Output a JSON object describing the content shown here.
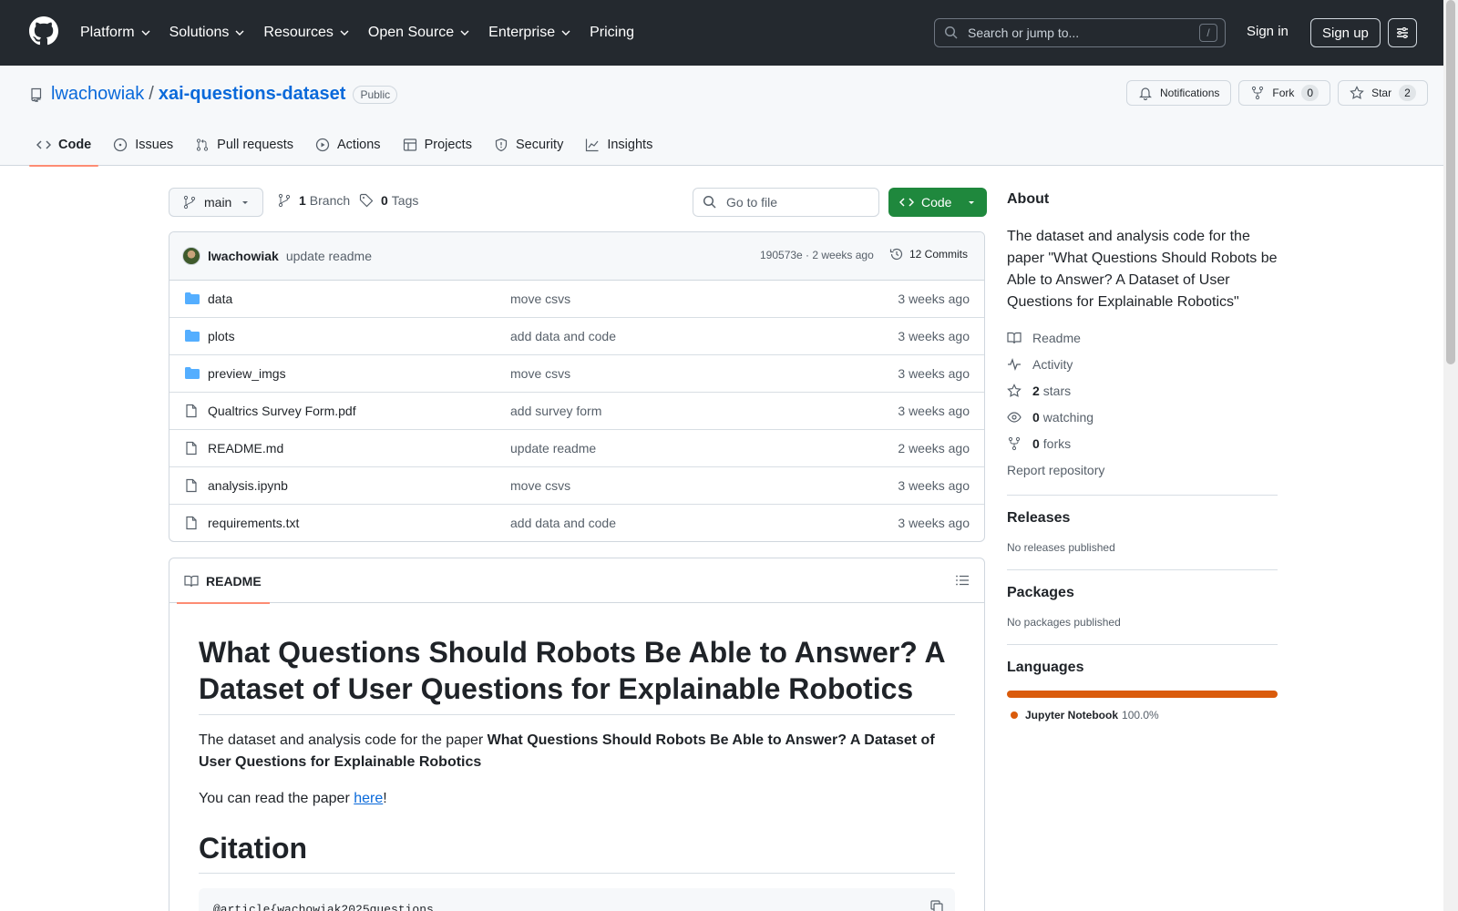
{
  "header": {
    "nav": [
      {
        "label": "Platform",
        "dropdown": true
      },
      {
        "label": "Solutions",
        "dropdown": true
      },
      {
        "label": "Resources",
        "dropdown": true
      },
      {
        "label": "Open Source",
        "dropdown": true
      },
      {
        "label": "Enterprise",
        "dropdown": true
      },
      {
        "label": "Pricing",
        "dropdown": false
      }
    ],
    "search_placeholder": "Search or jump to...",
    "search_key": "/",
    "sign_in": "Sign in",
    "sign_up": "Sign up"
  },
  "repo": {
    "owner": "lwachowiak",
    "separator": "/",
    "name": "xai-questions-dataset",
    "visibility": "Public",
    "actions": {
      "notifications": "Notifications",
      "fork": "Fork",
      "fork_count": "0",
      "star": "Star",
      "star_count": "2"
    },
    "tabs": [
      {
        "label": "Code",
        "icon": "code-icon",
        "active": true
      },
      {
        "label": "Issues",
        "icon": "issue-icon",
        "active": false
      },
      {
        "label": "Pull requests",
        "icon": "pull-request-icon",
        "active": false
      },
      {
        "label": "Actions",
        "icon": "play-icon",
        "active": false
      },
      {
        "label": "Projects",
        "icon": "table-icon",
        "active": false
      },
      {
        "label": "Security",
        "icon": "shield-icon",
        "active": false
      },
      {
        "label": "Insights",
        "icon": "graph-icon",
        "active": false
      }
    ]
  },
  "file_nav": {
    "branch": "main",
    "branches_count": "1",
    "branches_label": "Branch",
    "tags_count": "0",
    "tags_label": "Tags",
    "goto_placeholder": "Go to file",
    "code_button": "Code"
  },
  "latest_commit": {
    "author": "lwachowiak",
    "message": "update readme",
    "meta": "190573e · 2 weeks ago",
    "commits_label": "12 Commits"
  },
  "files": [
    {
      "name": "data",
      "type": "folder",
      "message": "move csvs",
      "date": "3 weeks ago"
    },
    {
      "name": "plots",
      "type": "folder",
      "message": "add data and code",
      "date": "3 weeks ago"
    },
    {
      "name": "preview_imgs",
      "type": "folder",
      "message": "move csvs",
      "date": "3 weeks ago"
    },
    {
      "name": "Qualtrics Survey Form.pdf",
      "type": "file",
      "message": "add survey form",
      "date": "3 weeks ago"
    },
    {
      "name": "README.md",
      "type": "file",
      "message": "update readme",
      "date": "2 weeks ago"
    },
    {
      "name": "analysis.ipynb",
      "type": "file",
      "message": "move csvs",
      "date": "3 weeks ago"
    },
    {
      "name": "requirements.txt",
      "type": "file",
      "message": "add data and code",
      "date": "3 weeks ago"
    }
  ],
  "readme": {
    "tab_label": "README",
    "title": "What Questions Should Robots Be Able to Answer? A Dataset of User Questions for Explainable Robotics",
    "intro_prefix": "The dataset and analysis code for the paper ",
    "intro_bold": "What Questions Should Robots Be Able to Answer? A Dataset of User Questions for Explainable Robotics",
    "read_prefix": "You can read the paper ",
    "read_link": "here",
    "read_suffix": "!",
    "citation_heading": "Citation",
    "code_preview": "@article{wachowiak2025questions,"
  },
  "about": {
    "heading": "About",
    "description": "The dataset and analysis code for the paper \"What Questions Should Robots be Able to Answer? A Dataset of User Questions for Explainable Robotics\"",
    "readme": "Readme",
    "activity": "Activity",
    "stars_count": "2",
    "stars_label": "stars",
    "watching_count": "0",
    "watching_label": "watching",
    "forks_count": "0",
    "forks_label": "forks",
    "report": "Report repository"
  },
  "releases": {
    "heading": "Releases",
    "text": "No releases published"
  },
  "packages": {
    "heading": "Packages",
    "text": "No packages published"
  },
  "languages": {
    "heading": "Languages",
    "items": [
      {
        "name": "Jupyter Notebook",
        "percent": "100.0%",
        "color": "#da5b0b"
      }
    ]
  },
  "colors": {
    "accent": "#0969da",
    "primary_button": "#1f883d",
    "active_tab": "#fd8c73",
    "header_bg": "#24292f"
  }
}
